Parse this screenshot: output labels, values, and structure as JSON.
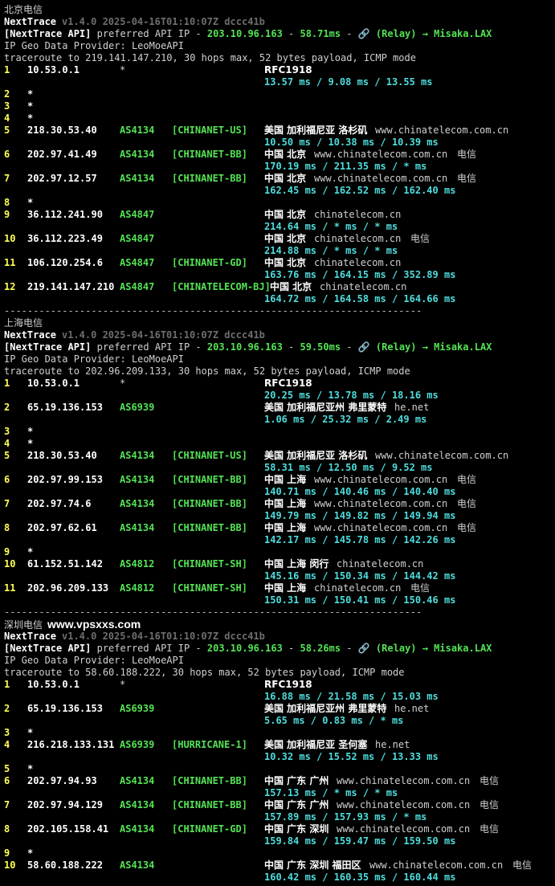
{
  "sections": [
    {
      "title": "北京电信",
      "watermark": "",
      "brand": "NextTrace",
      "version": "v1.4.0 2025-04-16T01:10:07Z dccc41b",
      "api_prefix": "[NextTrace API]",
      "api_mid": " preferred API IP - ",
      "api_ip": "203.10.96.163",
      "api_dash": " - ",
      "api_latency": "58.71ms",
      "api_sep": " - ",
      "api_relay": "🔗 (Relay) → Misaka.LAX",
      "geo_provider": "IP Geo Data Provider: LeoMoeAPI",
      "traceroute": "traceroute to 219.141.147.210, 30 hops max, 52 bytes payload, ICMP mode",
      "hops": [
        {
          "n": "1",
          "ip": "10.53.0.1",
          "asn": "*",
          "tag": "",
          "geo": "RFC1918",
          "host": "",
          "isp": "",
          "rtt": "13.57 ms / 9.08 ms / 13.55 ms"
        },
        {
          "n": "2",
          "ip": "*"
        },
        {
          "n": "3",
          "ip": "*"
        },
        {
          "n": "4",
          "ip": "*"
        },
        {
          "n": "5",
          "ip": "218.30.53.40",
          "asn": "AS4134",
          "tag": "[CHINANET-US]",
          "geo": "美国 加利福尼亚 洛杉矶",
          "host": "www.chinatelecom.com.cn",
          "isp": "",
          "rtt": "10.50 ms / 10.38 ms / 10.39 ms"
        },
        {
          "n": "6",
          "ip": "202.97.41.49",
          "asn": "AS4134",
          "tag": "[CHINANET-BB]",
          "geo": "中国 北京",
          "host": "www.chinatelecom.com.cn",
          "isp": "电信",
          "rtt": "170.19 ms / 211.35 ms / * ms"
        },
        {
          "n": "7",
          "ip": "202.97.12.57",
          "asn": "AS4134",
          "tag": "[CHINANET-BB]",
          "geo": "中国 北京",
          "host": "www.chinatelecom.com.cn",
          "isp": "电信",
          "rtt": "162.45 ms / 162.52 ms / 162.40 ms"
        },
        {
          "n": "8",
          "ip": "*"
        },
        {
          "n": "9",
          "ip": "36.112.241.90",
          "asn": "AS4847",
          "tag": "",
          "geo": "中国 北京",
          "host": "chinatelecom.cn",
          "isp": "",
          "rtt": "214.64 ms / * ms / * ms"
        },
        {
          "n": "10",
          "ip": "36.112.223.49",
          "asn": "AS4847",
          "tag": "",
          "geo": "中国 北京",
          "host": "chinatelecom.cn",
          "isp": "电信",
          "rtt": "214.88 ms / * ms / * ms"
        },
        {
          "n": "11",
          "ip": "106.120.254.6",
          "asn": "AS4847",
          "tag": "[CHINANET-GD]",
          "geo": "中国 北京",
          "host": "chinatelecom.cn",
          "isp": "",
          "rtt": "163.76 ms / 164.15 ms / 352.89 ms"
        },
        {
          "n": "12",
          "ip": "219.141.147.210",
          "asn": "AS4847",
          "tag": "[CHINATELECOM-BJ]",
          "geo": "中国 北京",
          "host": "chinatelecom.cn",
          "isp": "",
          "rtt": "164.72 ms / 164.58 ms / 164.66 ms"
        }
      ]
    },
    {
      "title": "上海电信",
      "watermark": "",
      "brand": "NextTrace",
      "version": "v1.4.0 2025-04-16T01:10:07Z dccc41b",
      "api_prefix": "[NextTrace API]",
      "api_mid": " preferred API IP - ",
      "api_ip": "203.10.96.163",
      "api_dash": " - ",
      "api_latency": "59.50ms",
      "api_sep": " - ",
      "api_relay": "🔗 (Relay) → Misaka.LAX",
      "geo_provider": "IP Geo Data Provider: LeoMoeAPI",
      "traceroute": "traceroute to 202.96.209.133, 30 hops max, 52 bytes payload, ICMP mode",
      "hops": [
        {
          "n": "1",
          "ip": "10.53.0.1",
          "asn": "*",
          "tag": "",
          "geo": "RFC1918",
          "host": "",
          "isp": "",
          "rtt": "20.25 ms / 13.78 ms / 18.16 ms"
        },
        {
          "n": "2",
          "ip": "65.19.136.153",
          "asn": "AS6939",
          "tag": "",
          "geo": "美国 加利福尼亚州 弗里蒙特",
          "host": "he.net",
          "isp": "",
          "rtt": "1.06 ms / 25.32 ms / 2.49 ms"
        },
        {
          "n": "3",
          "ip": "*"
        },
        {
          "n": "4",
          "ip": "*"
        },
        {
          "n": "5",
          "ip": "218.30.53.40",
          "asn": "AS4134",
          "tag": "[CHINANET-US]",
          "geo": "美国 加利福尼亚 洛杉矶",
          "host": "www.chinatelecom.com.cn",
          "isp": "",
          "rtt": "58.31 ms / 12.50 ms / 9.52 ms"
        },
        {
          "n": "6",
          "ip": "202.97.99.153",
          "asn": "AS4134",
          "tag": "[CHINANET-BB]",
          "geo": "中国 上海",
          "host": "www.chinatelecom.com.cn",
          "isp": "电信",
          "rtt": "140.71 ms / 140.46 ms / 140.40 ms"
        },
        {
          "n": "7",
          "ip": "202.97.74.6",
          "asn": "AS4134",
          "tag": "[CHINANET-BB]",
          "geo": "中国 上海",
          "host": "www.chinatelecom.com.cn",
          "isp": "电信",
          "rtt": "149.79 ms / 149.82 ms / 149.94 ms"
        },
        {
          "n": "8",
          "ip": "202.97.62.61",
          "asn": "AS4134",
          "tag": "[CHINANET-BB]",
          "geo": "中国 上海",
          "host": "www.chinatelecom.com.cn",
          "isp": "电信",
          "rtt": "142.17 ms / 145.78 ms / 142.26 ms"
        },
        {
          "n": "9",
          "ip": "*"
        },
        {
          "n": "10",
          "ip": "61.152.51.142",
          "asn": "AS4812",
          "tag": "[CHINANET-SH]",
          "geo": "中国 上海 闵行",
          "host": "chinatelecom.cn",
          "isp": "",
          "rtt": "145.16 ms / 150.34 ms / 144.42 ms"
        },
        {
          "n": "11",
          "ip": "202.96.209.133",
          "asn": "AS4812",
          "tag": "[CHINANET-SH]",
          "geo": "中国 上海",
          "host": "chinatelecom.cn",
          "isp": "电信",
          "rtt": "150.31 ms / 150.41 ms / 150.46 ms"
        }
      ]
    },
    {
      "title": "深圳电信",
      "watermark": "www.vpsxxs.com",
      "brand": "NextTrace",
      "version": "v1.4.0 2025-04-16T01:10:07Z dccc41b",
      "api_prefix": "[NextTrace API]",
      "api_mid": " preferred API IP - ",
      "api_ip": "203.10.96.163",
      "api_dash": " - ",
      "api_latency": "58.26ms",
      "api_sep": " - ",
      "api_relay": "🔗 (Relay) → Misaka.LAX",
      "geo_provider": "IP Geo Data Provider: LeoMoeAPI",
      "traceroute": "traceroute to 58.60.188.222, 30 hops max, 52 bytes payload, ICMP mode",
      "hops": [
        {
          "n": "1",
          "ip": "10.53.0.1",
          "asn": "*",
          "tag": "",
          "geo": "RFC1918",
          "host": "",
          "isp": "",
          "rtt": "16.88 ms / 21.58 ms / 15.03 ms"
        },
        {
          "n": "2",
          "ip": "65.19.136.153",
          "asn": "AS6939",
          "tag": "",
          "geo": "美国 加利福尼亚州 弗里蒙特",
          "host": "he.net",
          "isp": "",
          "rtt": "5.65 ms / 0.83 ms / * ms"
        },
        {
          "n": "3",
          "ip": "*"
        },
        {
          "n": "4",
          "ip": "216.218.133.131",
          "asn": "AS6939",
          "tag": "[HURRICANE-1]",
          "geo": "美国 加利福尼亚 圣何塞",
          "host": "he.net",
          "isp": "",
          "rtt": "10.32 ms / 15.52 ms / 13.33 ms"
        },
        {
          "n": "5",
          "ip": "*"
        },
        {
          "n": "6",
          "ip": "202.97.94.93",
          "asn": "AS4134",
          "tag": "[CHINANET-BB]",
          "geo": "中国 广东 广州",
          "host": "www.chinatelecom.com.cn",
          "isp": "电信",
          "rtt": "157.13 ms / * ms / * ms"
        },
        {
          "n": "7",
          "ip": "202.97.94.129",
          "asn": "AS4134",
          "tag": "[CHINANET-BB]",
          "geo": "中国 广东 广州",
          "host": "www.chinatelecom.com.cn",
          "isp": "电信",
          "rtt": "157.89 ms / 157.93 ms / * ms"
        },
        {
          "n": "8",
          "ip": "202.105.158.41",
          "asn": "AS4134",
          "tag": "[CHINANET-GD]",
          "geo": "中国 广东 深圳",
          "host": "www.chinatelecom.com.cn",
          "isp": "电信",
          "rtt": "159.84 ms / 159.47 ms / 159.50 ms"
        },
        {
          "n": "9",
          "ip": "*"
        },
        {
          "n": "10",
          "ip": "58.60.188.222",
          "asn": "AS4134",
          "tag": "",
          "geo": "中国 广东 深圳 福田区",
          "host": "www.chinatelecom.com.cn",
          "isp": "电信",
          "rtt": "160.42 ms / 160.35 ms / 160.44 ms"
        }
      ]
    }
  ],
  "separator": "------------------------------------------------------------------------",
  "colors": {
    "background": "#000000",
    "number": "#ffff54",
    "asn": "#54e354",
    "rtt": "#4fdcdc",
    "version": "#6e6e6e",
    "text": "#d0d0d0"
  }
}
